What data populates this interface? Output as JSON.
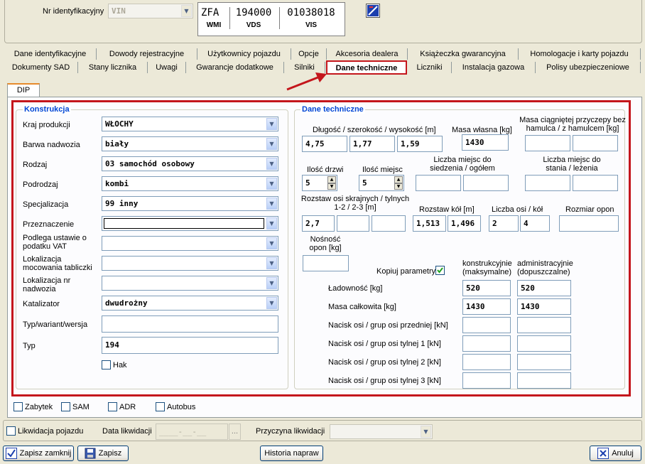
{
  "header": {
    "vin_label": "Nr identyfikacyjny",
    "vin_select": "VIN",
    "vin_parts": [
      {
        "value": "ZFA",
        "caption": "WMI"
      },
      {
        "value": "194000",
        "caption": "VDS"
      },
      {
        "value": "01038018",
        "caption": "VIS"
      }
    ]
  },
  "tabs_row1": [
    "Dane identyfikacyjne",
    "Dowody rejestracyjne",
    "Użytkownicy pojazdu",
    "Opcje",
    "Akcesoria dealera",
    "Książeczka gwarancyjna",
    "Homologacje i karty pojazdu"
  ],
  "tabs_row2": [
    "Dokumenty SAD",
    "Stany licznika",
    "Uwagi",
    "Gwarancje dodatkowe",
    "Silniki",
    "Dane techniczne",
    "Liczniki",
    "Instalacja gazowa",
    "Polisy ubezpieczeniowe"
  ],
  "subtab": "DIP",
  "konstrukcja": {
    "title": "Konstrukcja",
    "fields": [
      {
        "label": "Kraj produkcji",
        "value": "WŁOCHY"
      },
      {
        "label": "Barwa nadwozia",
        "value": "biały"
      },
      {
        "label": "Rodzaj",
        "code": "03",
        "value": "samochód osobowy"
      },
      {
        "label": "Podrodzaj",
        "value": "kombi"
      },
      {
        "label": "Specjalizacja",
        "code": "99",
        "value": "inny"
      },
      {
        "label": "Przeznaczenie",
        "value": ""
      },
      {
        "label": "Podlega ustawie o podatku VAT",
        "value": ""
      },
      {
        "label": "Lokalizacja mocowania tabliczki",
        "value": ""
      },
      {
        "label": "Lokalizacja nr nadwozia",
        "value": ""
      },
      {
        "label": "Katalizator",
        "value": "dwudrożny"
      }
    ],
    "typ_wariant_label": "Typ/wariant/wersja",
    "typ_wariant_value": "",
    "typ_label": "Typ",
    "typ_value": "194",
    "hak_label": "Hak"
  },
  "dane": {
    "title": "Dane techniczne",
    "dims_label": "Długość / szerokość / wysokość [m]",
    "dims": [
      "4,75",
      "1,77",
      "1,59"
    ],
    "masa_wlasna_label": "Masa własna [kg]",
    "masa_wlasna": "1430",
    "przyczepa_label": "Masa ciągniętej przyczepy bez hamulca / z hamulcem [kg]",
    "przyczepa": [
      "",
      ""
    ],
    "drzwi_label": "Ilość drzwi",
    "drzwi": "5",
    "miejsc_label": "Ilość miejsc",
    "miejsc": "5",
    "siedz_label": "Liczba miejsc do siedzenia / ogółem",
    "siedz": [
      "",
      ""
    ],
    "stania_label": "Liczba miejsc do stania / leżenia",
    "stania": [
      "",
      ""
    ],
    "rozstaw_osi_label": "Rozstaw osi skrajnych / tylnych 1-2 / 2-3 [m]",
    "rozstaw_osi": [
      "2,7",
      "",
      ""
    ],
    "rozstaw_kol_label": "Rozstaw kół [m]",
    "rozstaw_kol": [
      "1,513",
      "1,496"
    ],
    "osi_kol_label": "Liczba osi / kół",
    "osi_kol": [
      "2",
      "4"
    ],
    "opony_label": "Rozmiar opon",
    "opony": "",
    "nosnosc_label": "Nośność opon [kg]",
    "nosnosc": "",
    "kopiuj_label": "Kopiuj parametry",
    "col1": "konstrukcyjnie (maksymalne)",
    "col2": "administracyjnie (dopuszczalne)",
    "rows": [
      {
        "label": "Ładowność [kg]",
        "v1": "520",
        "v2": "520"
      },
      {
        "label": "Masa całkowita [kg]",
        "v1": "1430",
        "v2": "1430"
      },
      {
        "label": "Nacisk osi / grup osi przedniej [kN]",
        "v1": "",
        "v2": ""
      },
      {
        "label": "Nacisk osi / grup osi tylnej 1 [kN]",
        "v1": "",
        "v2": ""
      },
      {
        "label": "Nacisk osi / grup osi tylnej 2 [kN]",
        "v1": "",
        "v2": ""
      },
      {
        "label": "Nacisk osi / grup osi tylnej 3 [kN]",
        "v1": "",
        "v2": ""
      }
    ]
  },
  "flags": [
    "Zabytek",
    "SAM",
    "ADR",
    "Autobus"
  ],
  "likwidacja": {
    "checkbox_label": "Likwidacja pojazdu",
    "data_label": "Data likwidacji",
    "data_value": "____-__-__",
    "date_btn": "...",
    "przyczyna_label": "Przyczyna likwidacji"
  },
  "buttons": {
    "save_close": "Zapisz zamknij",
    "save": "Zapisz",
    "history": "Historia napraw",
    "cancel": "Anuluj"
  }
}
